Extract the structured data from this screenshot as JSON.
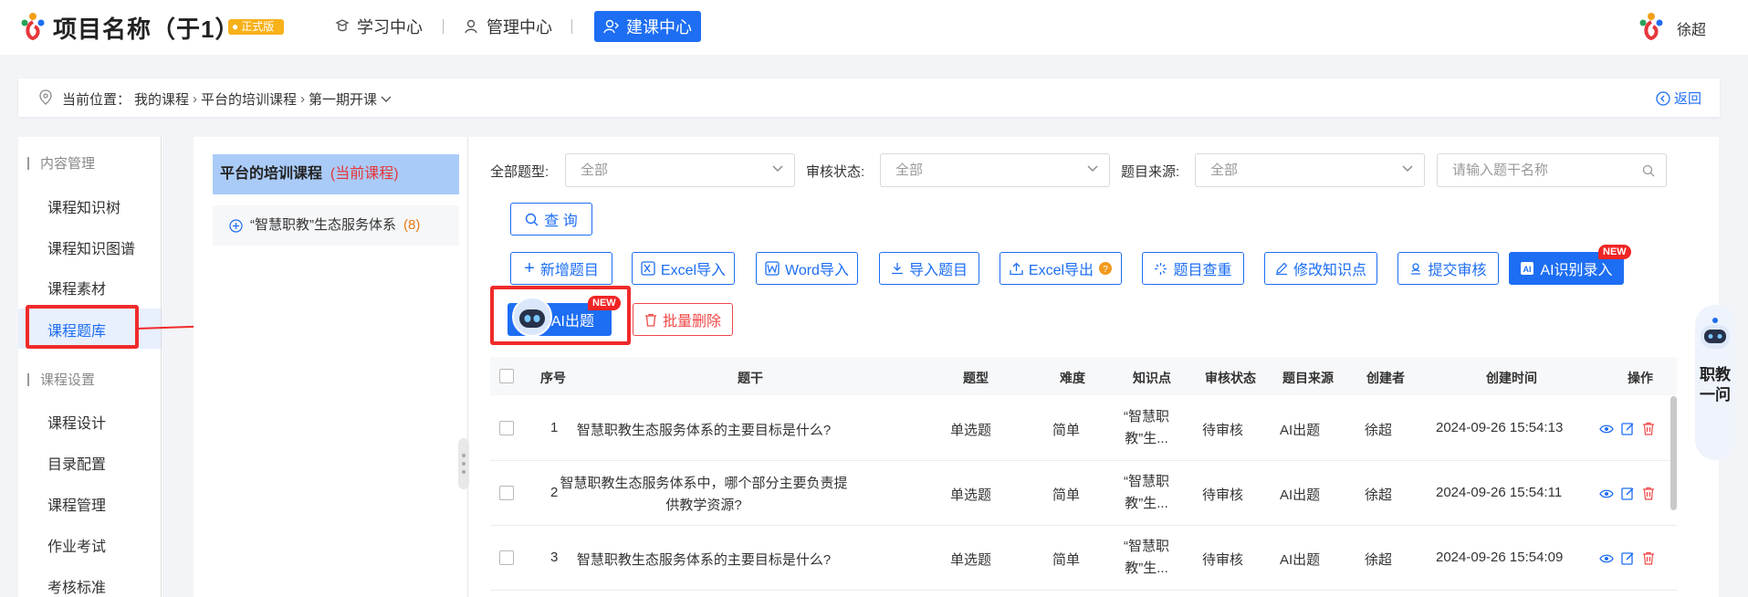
{
  "header": {
    "project_title": "项目名称（于1）",
    "version_badge": "正式版",
    "nav": [
      "学习中心",
      "管理中心",
      "建课中心"
    ],
    "user_name": "徐超"
  },
  "breadcrumb": {
    "label": "当前位置：",
    "path": [
      "我的课程",
      "平台的培训课程",
      "第一期开课"
    ],
    "back": "返回"
  },
  "sidebar": {
    "group1": "内容管理",
    "group1_items": [
      "课程知识树",
      "课程知识图谱",
      "课程素材",
      "课程题库"
    ],
    "group2": "课程设置",
    "group2_items": [
      "课程设计",
      "目录配置",
      "课程管理",
      "作业考试",
      "考核标准"
    ]
  },
  "course_panel": {
    "active_name": "平台的培训课程",
    "active_tag": "(当前课程)",
    "sub_name": "“智慧职教”生态服务体系",
    "sub_count": "(8)"
  },
  "filters": {
    "type_label": "全部题型:",
    "type_value": "全部",
    "audit_label": "审核状态:",
    "audit_value": "全部",
    "source_label": "题目来源:",
    "source_value": "全部",
    "search_placeholder": "请输入题干名称",
    "query_btn": "查 询"
  },
  "toolbar": [
    "新增题目",
    "Excel导入",
    "Word导入",
    "导入题目",
    "Excel导出",
    "题目查重",
    "修改知识点",
    "提交审核",
    "AI识别录入"
  ],
  "toolbar2": {
    "ai_btn": "AI出题",
    "batch_delete": "批量删除",
    "new_tag": "NEW"
  },
  "table": {
    "headers": [
      "序号",
      "题干",
      "题型",
      "难度",
      "知识点",
      "审核状态",
      "题目来源",
      "创建者",
      "创建时间",
      "操作"
    ],
    "rows": [
      {
        "no": "1",
        "stem": "智慧职教生态服务体系的主要目标是什么?",
        "stem2": "",
        "type": "单选题",
        "level": "简单",
        "kp1": "“智慧职",
        "kp2": "教”生...",
        "audit": "待审核",
        "source": "AI出题",
        "creator": "徐超",
        "time": "2024-09-26 15:54:13"
      },
      {
        "no": "2",
        "stem": "智慧职教生态服务体系中，哪个部分主要负责提",
        "stem2": "供教学资源?",
        "type": "单选题",
        "level": "简单",
        "kp1": "“智慧职",
        "kp2": "教”生...",
        "audit": "待审核",
        "source": "AI出题",
        "creator": "徐超",
        "time": "2024-09-26 15:54:11"
      },
      {
        "no": "3",
        "stem": "智慧职教生态服务体系的主要目标是什么?",
        "stem2": "",
        "type": "单选题",
        "level": "简单",
        "kp1": "“智慧职",
        "kp2": "教”生...",
        "audit": "待审核",
        "source": "AI出题",
        "creator": "徐超",
        "time": "2024-09-26 15:54:09"
      }
    ]
  },
  "assistant": {
    "label": "职教一问"
  },
  "colors": {
    "primary": "#1d6ef3",
    "highlight": "#f02a2a"
  }
}
